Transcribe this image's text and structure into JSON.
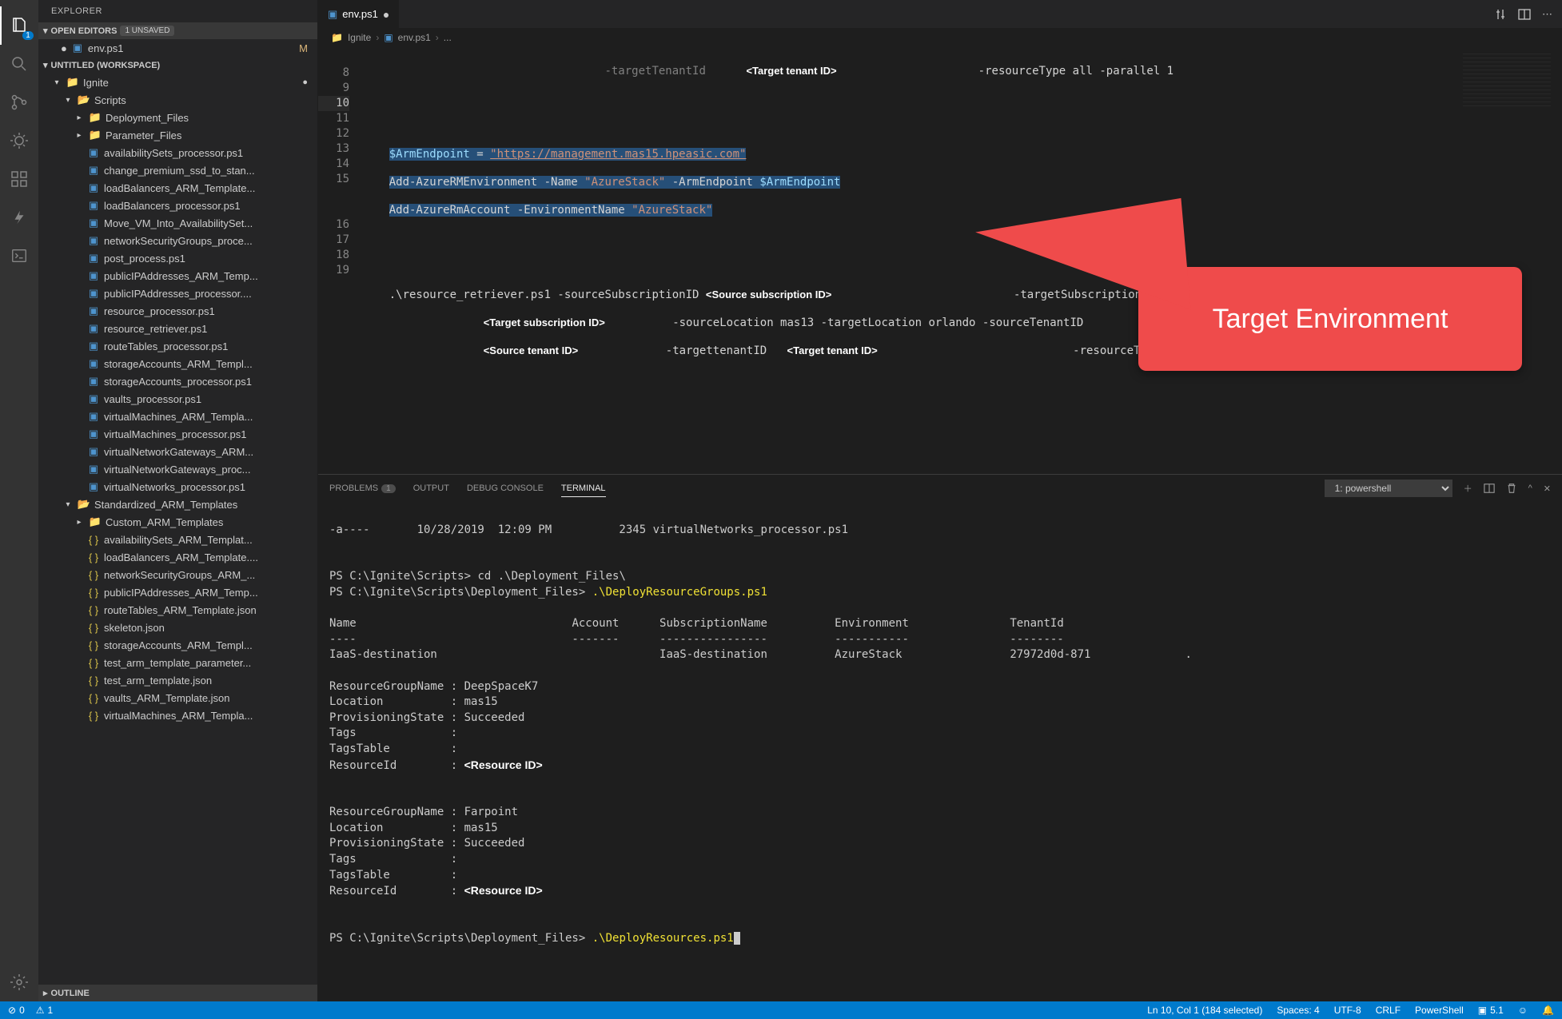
{
  "sidebar": {
    "title": "EXPLORER",
    "openEditors": {
      "label": "OPEN EDITORS",
      "unsaved": "1 UNSAVED",
      "items": [
        {
          "name": "env.ps1",
          "modified": true,
          "m": "M"
        }
      ]
    },
    "workspace": {
      "label": "UNTITLED (WORKSPACE)",
      "root": "Ignite",
      "scripts": "Scripts",
      "deployment": "Deployment_Files",
      "parameter": "Parameter_Files",
      "files": [
        "availabilitySets_processor.ps1",
        "change_premium_ssd_to_stan...",
        "loadBalancers_ARM_Template...",
        "loadBalancers_processor.ps1",
        "Move_VM_Into_AvailabilitySet...",
        "networkSecurityGroups_proce...",
        "post_process.ps1",
        "publicIPAddresses_ARM_Temp...",
        "publicIPAddresses_processor....",
        "resource_processor.ps1",
        "resource_retriever.ps1",
        "routeTables_processor.ps1",
        "storageAccounts_ARM_Templ...",
        "storageAccounts_processor.ps1",
        "vaults_processor.ps1",
        "virtualMachines_ARM_Templa...",
        "virtualMachines_processor.ps1",
        "virtualNetworkGateways_ARM...",
        "virtualNetworkGateways_proc...",
        "virtualNetworks_processor.ps1"
      ],
      "std": "Standardized_ARM_Templates",
      "custom": "Custom_ARM_Templates",
      "jsonFiles": [
        "availabilitySets_ARM_Templat...",
        "loadBalancers_ARM_Template....",
        "networkSecurityGroups_ARM_...",
        "publicIPAddresses_ARM_Temp...",
        "routeTables_ARM_Template.json",
        "skeleton.json",
        "storageAccounts_ARM_Templ...",
        "test_arm_template_parameter...",
        "test_arm_template.json",
        "vaults_ARM_Template.json",
        "virtualMachines_ARM_Templa..."
      ]
    },
    "outline": "OUTLINE"
  },
  "tabs": {
    "active": "env.ps1"
  },
  "breadcrumb": {
    "folder": "Ignite",
    "file": "env.ps1",
    "more": "..."
  },
  "editor": {
    "lineStart": 8,
    "line7_param": "-targetTenantId",
    "line7_annot": "<Target tenant ID>",
    "line7_tail": "-resourceType all -parallel 1",
    "line10_var": "$ArmEndpoint",
    "line10_eq": " = ",
    "line10_str": "\"https://management.mas15.hpeasic.com\"",
    "line11": "Add-AzureRMEnvironment -Name ",
    "line11_str": "\"AzureStack\"",
    "line11_b": " -ArmEndpoint ",
    "line11_var": "$ArmEndpoint",
    "line12": "Add-AzureRmAccount -EnvironmentName ",
    "line12_str": "\"AzureStack\"",
    "line15": ".\\resource_retriever.ps1 -sourceSubscriptionID ",
    "line15_a1": "<Source subscription ID>",
    "line15_tail": "-targetSubscriptionID",
    "line15b_a1": "<Target subscription ID>",
    "line15b_mid": " -sourceLocation mas13 -targetLocation orlando -sourceTenantID",
    "line15c_a1": "<Source tenant ID>",
    "line15c_mid": "-targettenantID",
    "line15c_a2": "<Target tenant ID>",
    "line15c_tail": "-resourceType all"
  },
  "callout": {
    "text": "Target Environment"
  },
  "panel": {
    "tabs": {
      "problems": "PROBLEMS",
      "problemsCount": "1",
      "output": "OUTPUT",
      "debug": "DEBUG CONSOLE",
      "terminal": "TERMINAL"
    },
    "dropdown": "1: powershell",
    "terminal": {
      "pre": "-a----       10/28/2019  12:09 PM          2345 virtualNetworks_processor.ps1",
      "ps1": "PS C:\\Ignite\\Scripts> ",
      "cd": "cd .\\Deployment_Files\\",
      "ps2": "PS C:\\Ignite\\Scripts\\Deployment_Files> ",
      "cmd2": ".\\DeployResourceGroups.ps1",
      "hdr_name": "Name",
      "hdr_account": "Account",
      "hdr_sub": "SubscriptionName",
      "hdr_env": "Environment",
      "hdr_tenant": "TenantId",
      "row_name": "IaaS-destination",
      "row_sub": "IaaS-destination",
      "row_env": "AzureStack",
      "row_tenant": "27972d0d-871",
      "rg1": {
        "name": "ResourceGroupName : DeepSpaceK7",
        "loc": "Location          : mas15",
        "prov": "ProvisioningState : Succeeded",
        "tags": "Tags              :",
        "tt": "TagsTable         :",
        "rid": "ResourceId        : ",
        "rid_a": "<Resource ID>"
      },
      "rg2": {
        "name": "ResourceGroupName : Farpoint",
        "loc": "Location          : mas15",
        "prov": "ProvisioningState : Succeeded",
        "tags": "Tags              :",
        "tt": "TagsTable         :",
        "rid": "ResourceId        : ",
        "rid_a": "<Resource ID>"
      },
      "ps3": "PS C:\\Ignite\\Scripts\\Deployment_Files> ",
      "cmd3": ".\\DeployResources.ps1"
    }
  },
  "status": {
    "errors": "0",
    "warnings": "1",
    "cursor": "Ln 10, Col 1 (184 selected)",
    "spaces": "Spaces: 4",
    "encoding": "UTF-8",
    "eol": "CRLF",
    "lang": "PowerShell",
    "ps": "5.1"
  }
}
